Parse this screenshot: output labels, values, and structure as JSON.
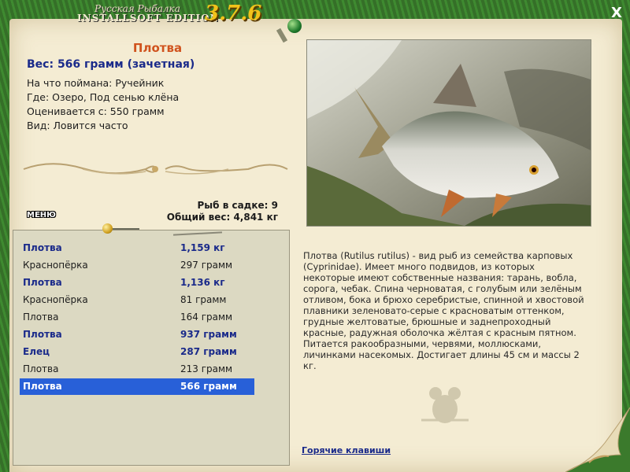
{
  "app": {
    "logo_line1": "Русская Рыбалка",
    "logo_line2": "INSTALLSOFT EDITION",
    "version": "3.7.6",
    "close_glyph": "X"
  },
  "fish": {
    "name": "Плотва",
    "weight_line": "Вес: 566 грамм (зачетная)",
    "info": [
      "На что поймана: Ручейник",
      "Где: Озеро, Под сенью клёна",
      "Оценивается с: 550 грамм",
      "Вид: Ловится часто"
    ]
  },
  "sadok": {
    "count_line": "Рыб в садке: 9",
    "total_line": "Общий вес: 4,841 кг"
  },
  "menu": {
    "label": "МЕНЮ"
  },
  "catch_list": [
    {
      "name": "Плотва",
      "weight": "1,159 кг",
      "bold": true,
      "selected": false
    },
    {
      "name": "Краснопёрка",
      "weight": "297 грамм",
      "bold": false,
      "selected": false
    },
    {
      "name": "Плотва",
      "weight": "1,136 кг",
      "bold": true,
      "selected": false
    },
    {
      "name": "Краснопёрка",
      "weight": "81 грамм",
      "bold": false,
      "selected": false
    },
    {
      "name": "Плотва",
      "weight": "164 грамм",
      "bold": false,
      "selected": false
    },
    {
      "name": "Плотва",
      "weight": "937 грамм",
      "bold": true,
      "selected": false
    },
    {
      "name": "Елец",
      "weight": "287 грамм",
      "bold": true,
      "selected": false
    },
    {
      "name": "Плотва",
      "weight": "213 грамм",
      "bold": false,
      "selected": false
    },
    {
      "name": "Плотва",
      "weight": "566 грамм",
      "bold": true,
      "selected": true
    }
  ],
  "description": "Плотва (Rutilus rutilus) - вид рыб из семейства карповых (Cyprinidae). Имеет много подвидов, из которых некоторые имеют собственные названия: тарань, вобла, сорога, чебак. Спина черноватая, с голубым или зелёным отливом, бока и брюхо серебристые, спинной и хвостовой плавники зеленовато-серые с красноватым оттенком, грудные желтоватые, брюшные и заднепроходный красные, радужная оболочка жёлтая с красным пятном. Питается ракообразными, червями, моллюсками, личинками насекомых. Достигает длины 45 см и массы 2 кг.",
  "hotkeys": {
    "label": "Горячие клавиши"
  },
  "colors": {
    "selected_row": "#2860d8",
    "bold_text": "#1a2a8a",
    "fish_name": "#d0531e",
    "version": "#f2c21a"
  }
}
